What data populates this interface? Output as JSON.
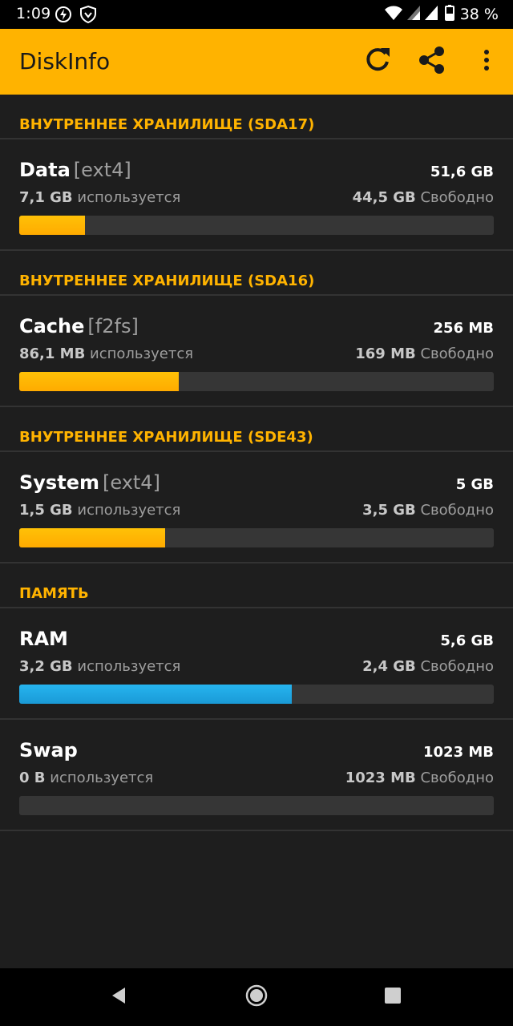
{
  "status_bar": {
    "time": "1:09",
    "battery_text": "38 %",
    "left_icons": [
      "flash-icon",
      "shield-icon"
    ],
    "right_icons": [
      "wifi-icon",
      "signal-icon",
      "signal-icon",
      "battery-icon"
    ]
  },
  "app_bar": {
    "title": "DiskInfo",
    "actions": [
      "refresh-icon",
      "share-icon",
      "more-vert-icon"
    ]
  },
  "colors": {
    "accent": "#ffb300",
    "background": "#1e1e1e",
    "ram_bar": "#1a9ad6",
    "bar_track": "#363636"
  },
  "sections": [
    {
      "header": "ВНУТРЕННЕЕ ХРАНИЛИЩЕ (SDA17)",
      "items": [
        {
          "name": "Data",
          "fs": "[ext4]",
          "total": "51,6 GB",
          "used_value": "7,1 GB",
          "used_label": "используется",
          "free_value": "44,5 GB",
          "free_label": "Свободно",
          "fraction_used": 0.138,
          "bar_color": "orange"
        }
      ]
    },
    {
      "header": "ВНУТРЕННЕЕ ХРАНИЛИЩЕ (SDA16)",
      "items": [
        {
          "name": "Cache",
          "fs": "[f2fs]",
          "total": "256 MB",
          "used_value": "86,1 MB",
          "used_label": "используется",
          "free_value": "169 MB",
          "free_label": "Свободно",
          "fraction_used": 0.336,
          "bar_color": "orange"
        }
      ]
    },
    {
      "header": "ВНУТРЕННЕЕ ХРАНИЛИЩЕ (SDE43)",
      "items": [
        {
          "name": "System",
          "fs": "[ext4]",
          "total": "5 GB",
          "used_value": "1,5 GB",
          "used_label": "используется",
          "free_value": "3,5 GB",
          "free_label": "Свободно",
          "fraction_used": 0.307,
          "bar_color": "orange"
        }
      ]
    },
    {
      "header": "ПАМЯТЬ",
      "items": [
        {
          "name": "RAM",
          "fs": "",
          "total": "5,6 GB",
          "used_value": "3,2 GB",
          "used_label": "используется",
          "free_value": "2,4 GB",
          "free_label": "Свободно",
          "fraction_used": 0.574,
          "bar_color": "blue"
        },
        {
          "name": "Swap",
          "fs": "",
          "total": "1023 MB",
          "used_value": "0 B",
          "used_label": "используется",
          "free_value": "1023 MB",
          "free_label": "Свободно",
          "fraction_used": 0,
          "bar_color": "orange"
        }
      ]
    }
  ],
  "nav_bar": {
    "buttons": [
      "back-icon",
      "home-icon",
      "recents-icon"
    ]
  }
}
